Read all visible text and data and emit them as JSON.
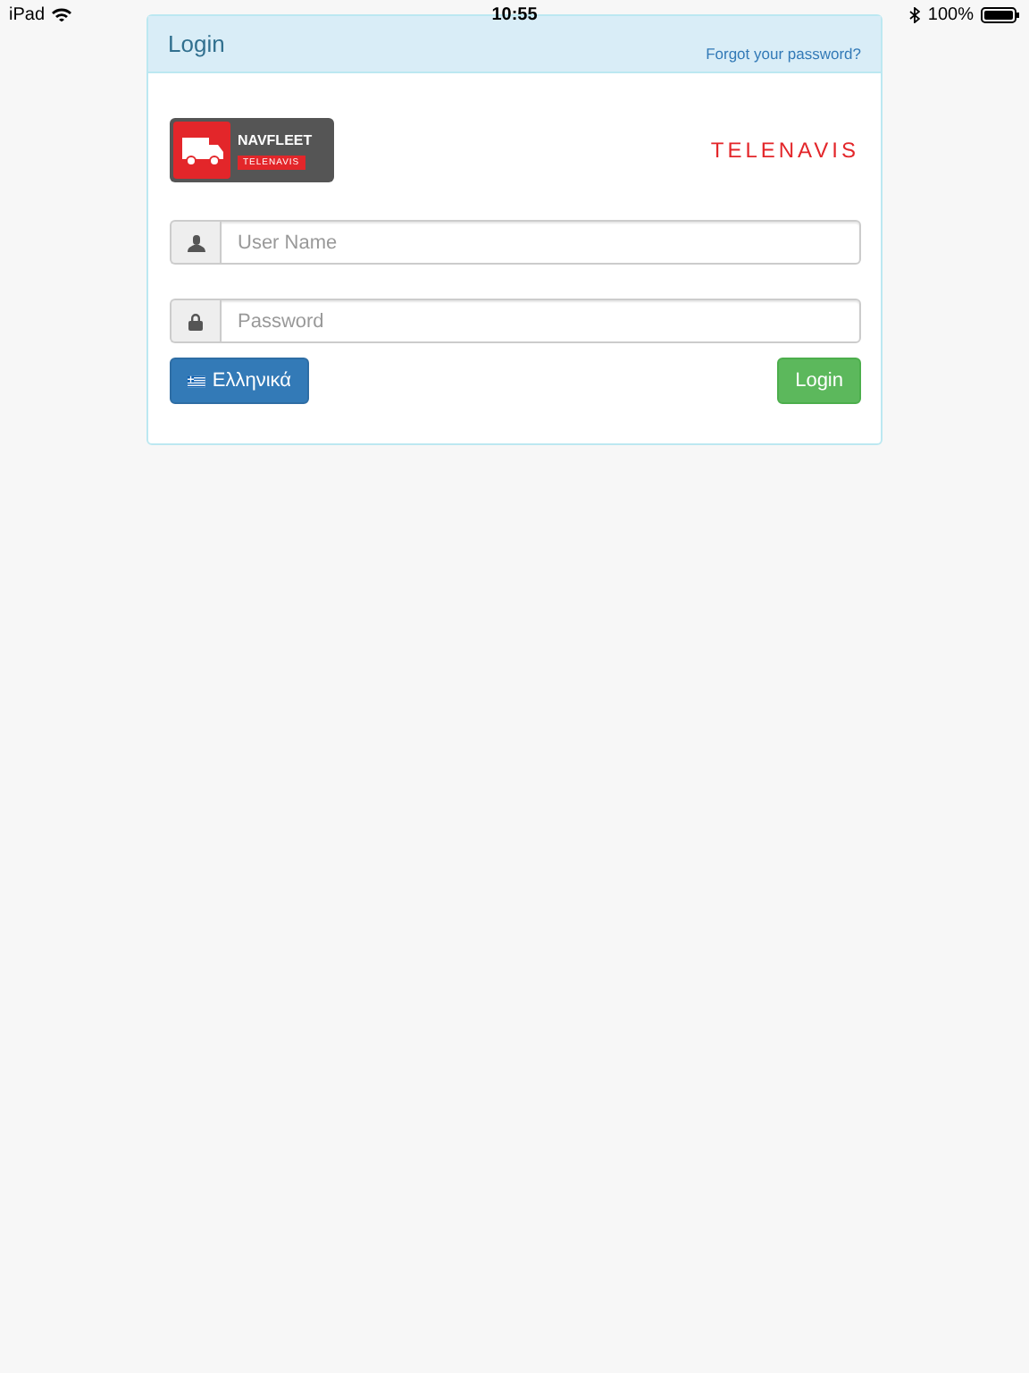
{
  "status_bar": {
    "device": "iPad",
    "time": "10:55",
    "battery": "100%"
  },
  "panel": {
    "title": "Login",
    "forgot_link": "Forgot your password?"
  },
  "logo": {
    "name": "NAVFLEET",
    "brand": "TELENAVIS"
  },
  "brand_logo": "TELENAVIS",
  "fields": [
    {
      "kind": "user",
      "placeholder": "User Name"
    },
    {
      "kind": "lock",
      "placeholder": "Password"
    }
  ],
  "language_button": "Ελληνικά",
  "login_button": "Login"
}
